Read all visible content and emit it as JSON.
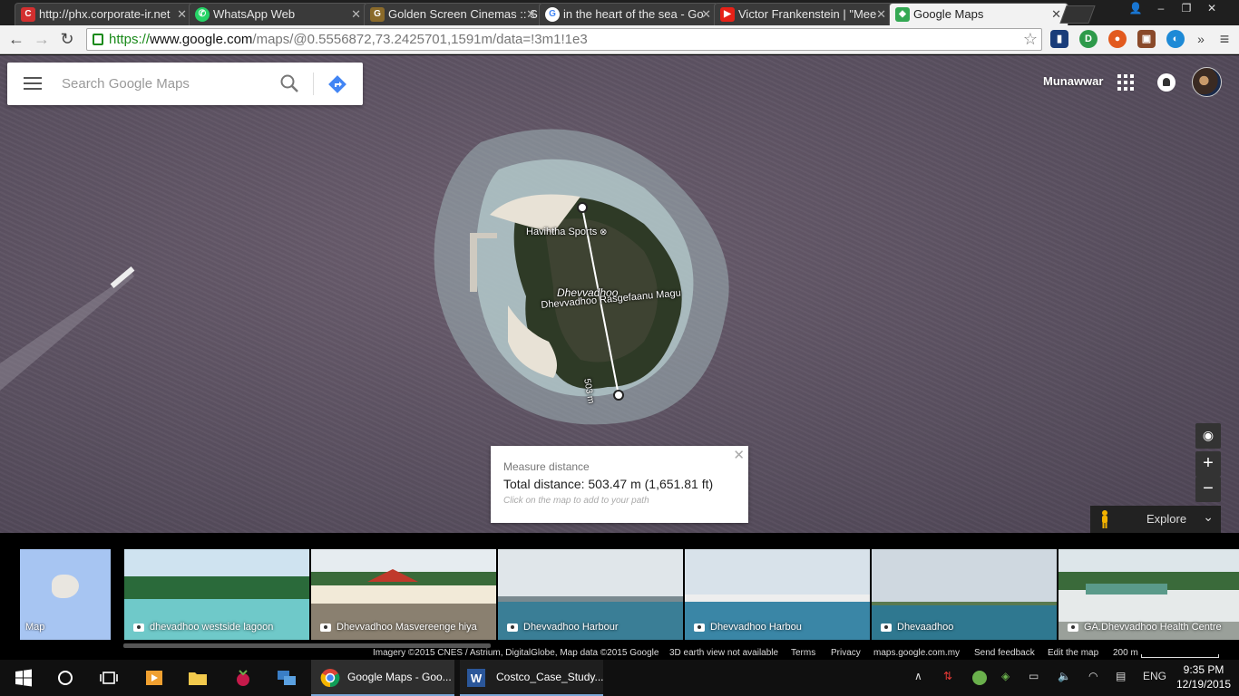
{
  "browser": {
    "tabs": [
      {
        "title": "http://phx.corporate-ir.net",
        "icon": "corporate-ir-icon",
        "color": "#d32f2f"
      },
      {
        "title": "WhatsApp Web",
        "icon": "whatsapp-icon",
        "color": "#25d366"
      },
      {
        "title": "Golden Screen Cinemas :: S",
        "icon": "gsc-icon",
        "color": "#8a6a2a"
      },
      {
        "title": "in the heart of the sea - Go",
        "icon": "google-icon",
        "color": "#4285f4"
      },
      {
        "title": "Victor Frankenstein | \"Mee",
        "icon": "youtube-icon",
        "color": "#e62117"
      },
      {
        "title": "Google Maps",
        "icon": "google-maps-icon",
        "color": "#34a853"
      }
    ],
    "close_glyph": "✕",
    "url": {
      "scheme": "https://",
      "host": "www.google.com",
      "path": "/maps/@0.5556872,73.2425701,1591m/data=!3m1!1e3"
    }
  },
  "maps": {
    "search_placeholder": "Search Google Maps",
    "account_name": "Munawwar",
    "labels": {
      "place": "Havihtha Sports",
      "island": "Dhevvadhoo",
      "street": "Dhevvadhoo Rasgefaanu Magu",
      "path_distance": "503 m"
    },
    "measure": {
      "title": "Measure distance",
      "total": "Total distance: 503.47 m (1,651.81 ft)",
      "hint": "Click on the map to add to your path"
    },
    "controls": {
      "zoom_in": "+",
      "zoom_out": "−",
      "explore": "Explore"
    },
    "strip": {
      "map_label": "Map",
      "photos": [
        {
          "caption": "dhevadhoo westside lagoon"
        },
        {
          "caption": "Dhevvadhoo Masvereenge hiya"
        },
        {
          "caption": "Dhevvadhoo Harbour"
        },
        {
          "caption": "Dhevvadhoo Harbou"
        },
        {
          "caption": "Dhevaadhoo"
        },
        {
          "caption": "GA.Dhevvadhoo Health Centre"
        }
      ]
    },
    "footer": {
      "imagery": "Imagery ©2015 CNES / Astrium, DigitalGlobe, Map data ©2015 Google",
      "earth_view": "3D earth view not available",
      "terms": "Terms",
      "privacy": "Privacy",
      "domain": "maps.google.com.my",
      "feedback": "Send feedback",
      "edit": "Edit the map",
      "scale": "200 m"
    }
  },
  "taskbar": {
    "apps": [
      {
        "label": "Google Maps - Goo..."
      },
      {
        "label": "Costco_Case_Study..."
      }
    ],
    "language": "ENG",
    "time": "9:35 PM",
    "date": "12/19/2015"
  }
}
